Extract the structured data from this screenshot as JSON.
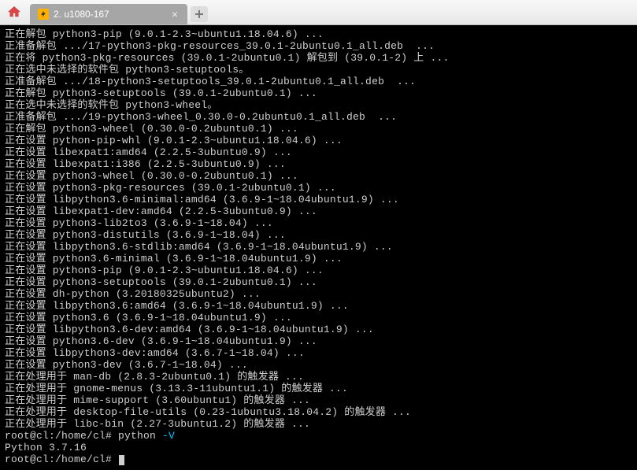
{
  "tab": {
    "title": "2. u1080-167"
  },
  "terminal": {
    "lines": [
      "正在解包 python3-pip (9.0.1-2.3~ubuntu1.18.04.6) ...",
      "正准备解包 .../17-python3-pkg-resources_39.0.1-2ubuntu0.1_all.deb  ...",
      "正在将 python3-pkg-resources (39.0.1-2ubuntu0.1) 解包到 (39.0.1-2) 上 ...",
      "正在选中未选择的软件包 python3-setuptools。",
      "正准备解包 .../18-python3-setuptools_39.0.1-2ubuntu0.1_all.deb  ...",
      "正在解包 python3-setuptools (39.0.1-2ubuntu0.1) ...",
      "正在选中未选择的软件包 python3-wheel。",
      "正准备解包 .../19-python3-wheel_0.30.0-0.2ubuntu0.1_all.deb  ...",
      "正在解包 python3-wheel (0.30.0-0.2ubuntu0.1) ...",
      "正在设置 python-pip-whl (9.0.1-2.3~ubuntu1.18.04.6) ...",
      "正在设置 libexpat1:amd64 (2.2.5-3ubuntu0.9) ...",
      "正在设置 libexpat1:i386 (2.2.5-3ubuntu0.9) ...",
      "正在设置 python3-wheel (0.30.0-0.2ubuntu0.1) ...",
      "正在设置 python3-pkg-resources (39.0.1-2ubuntu0.1) ...",
      "正在设置 libpython3.6-minimal:amd64 (3.6.9-1~18.04ubuntu1.9) ...",
      "正在设置 libexpat1-dev:amd64 (2.2.5-3ubuntu0.9) ...",
      "正在设置 python3-lib2to3 (3.6.9-1~18.04) ...",
      "正在设置 python3-distutils (3.6.9-1~18.04) ...",
      "正在设置 libpython3.6-stdlib:amd64 (3.6.9-1~18.04ubuntu1.9) ...",
      "正在设置 python3.6-minimal (3.6.9-1~18.04ubuntu1.9) ...",
      "正在设置 python3-pip (9.0.1-2.3~ubuntu1.18.04.6) ...",
      "正在设置 python3-setuptools (39.0.1-2ubuntu0.1) ...",
      "正在设置 dh-python (3.20180325ubuntu2) ...",
      "正在设置 libpython3.6:amd64 (3.6.9-1~18.04ubuntu1.9) ...",
      "正在设置 python3.6 (3.6.9-1~18.04ubuntu1.9) ...",
      "正在设置 libpython3.6-dev:amd64 (3.6.9-1~18.04ubuntu1.9) ...",
      "正在设置 python3.6-dev (3.6.9-1~18.04ubuntu1.9) ...",
      "正在设置 libpython3-dev:amd64 (3.6.7-1~18.04) ...",
      "正在设置 python3-dev (3.6.7-1~18.04) ...",
      "正在处理用于 man-db (2.8.3-2ubuntu0.1) 的触发器 ...",
      "正在处理用于 gnome-menus (3.13.3-11ubuntu1.1) 的触发器 ...",
      "正在处理用于 mime-support (3.60ubuntu1) 的触发器 ...",
      "正在处理用于 desktop-file-utils (0.23-1ubuntu3.18.04.2) 的触发器 ...",
      "正在处理用于 libc-bin (2.27-3ubuntu1.2) 的触发器 ..."
    ],
    "prompt1_left": "root@cl:/home/cl# python ",
    "prompt1_flag": "-V",
    "version_line": "Python 3.7.16",
    "prompt2": "root@cl:/home/cl# "
  }
}
